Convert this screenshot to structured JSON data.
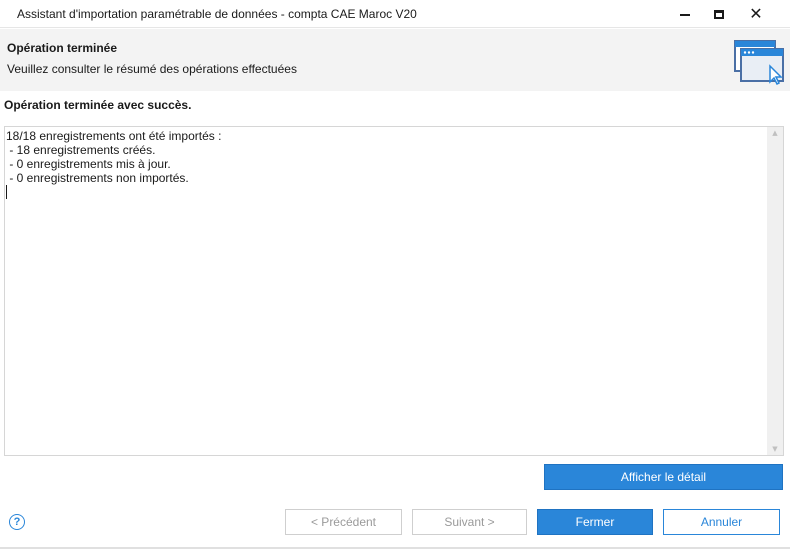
{
  "window": {
    "title": "Assistant d'importation paramétrable de données - compta CAE Maroc V20",
    "minimize_icon": "minimize-icon",
    "maximize_icon": "maximize-icon",
    "close_glyph": "✕"
  },
  "header": {
    "title": "Opération terminée",
    "subtitle": "Veuillez consulter le résumé des opérations effectuées",
    "icon": "wizard-window-icon"
  },
  "result": {
    "status": "Opération terminée avec succès.",
    "summary": "18/18 enregistrements ont été importés :\n - 18 enregistrements créés.\n - 0 enregistrements mis à jour.\n - 0 enregistrements non importés."
  },
  "buttons": {
    "detail": "Afficher le détail",
    "previous": "< Précédent",
    "next": "Suivant >",
    "close": "Fermer",
    "cancel": "Annuler"
  },
  "help": {
    "glyph": "?"
  },
  "colors": {
    "accent": "#2a86d9",
    "header_bg": "#f3f3f3",
    "disabled_text": "#9a9a9a"
  }
}
